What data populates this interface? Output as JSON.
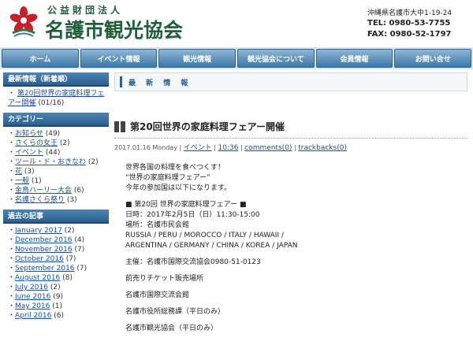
{
  "header": {
    "org_sub": "公益財団法人",
    "org_name": "名護市観光協会",
    "address": "沖縄県名護市大中1-19-24",
    "tel": "TEL: 0980-53-7755",
    "fax": "FAX: 0980-52-1797",
    "logo_icon": "sakura-flower-logo"
  },
  "nav": {
    "items": [
      "ホーム",
      "イベント情報",
      "観光情報",
      "観光協会について",
      "会員情報",
      "お問い合せ"
    ]
  },
  "sidebar": {
    "news": {
      "title": "最新情報（新着順）",
      "items": [
        {
          "label": "第20回世界の家庭料理フェアー開催",
          "count": "(01/16)"
        }
      ]
    },
    "categories": {
      "title": "カテゴリー",
      "items": [
        {
          "label": "お知らせ",
          "count": "(49)"
        },
        {
          "label": "さくらの女王",
          "count": "(2)"
        },
        {
          "label": "イベント",
          "count": "(44)"
        },
        {
          "label": "ツール・ド・おきなわ",
          "count": "(2)"
        },
        {
          "label": "花",
          "count": "(3)"
        },
        {
          "label": "一般",
          "count": "(1)"
        },
        {
          "label": "金鳥ハーリー大会",
          "count": "(6)"
        },
        {
          "label": "名護さくら祭り",
          "count": "(3)"
        }
      ]
    },
    "archive": {
      "title": "過去の記事",
      "items": [
        {
          "label": "January 2017",
          "count": "(2)"
        },
        {
          "label": "December 2016",
          "count": "(4)"
        },
        {
          "label": "November 2016",
          "count": "(7)"
        },
        {
          "label": "October 2016",
          "count": "(7)"
        },
        {
          "label": "September 2016",
          "count": "(7)"
        },
        {
          "label": "August 2016",
          "count": "(8)"
        },
        {
          "label": "July 2016",
          "count": "(2)"
        },
        {
          "label": "June 2016",
          "count": "(9)"
        },
        {
          "label": "May 2016",
          "count": "(1)"
        },
        {
          "label": "April 2016",
          "count": "(6)"
        }
      ]
    }
  },
  "main": {
    "section_title": "最 新 情 報",
    "entry": {
      "title": "第20回世界の家庭料理フェアー開催",
      "date": "2017.01.16 Monday",
      "category": "イベント",
      "time": "10:36",
      "comments": "comments(0)",
      "trackbacks": "trackbacks(0)",
      "body": [
        "世界各国の料理を食べつくす！",
        "“世界の家庭料理フェアー”",
        "今年の参加国は以下になります。",
        "",
        "■ 第20回 世界の家庭料理フェアー ■",
        "日時：2017年2月5日（日）11:30-15:00",
        "場所：名護市民会館",
        "RUSSIA / PERU / MOROCCO / ITALY / HAWAII /",
        "ARGENTINA / GERMANY / CHINA / KOREA / JAPAN",
        "",
        "主催：名護市国際交流協会0980-51-0123",
        "",
        "前売りチケット販売場所",
        "",
        "名護市国際交流会館",
        "",
        "名護市役所総務課（平日のみ）",
        "",
        "名護市観光協会（平日のみ）"
      ]
    }
  },
  "colors": {
    "brand_green": "#1f5f3a",
    "nav_blue": "#3d78a8",
    "link_blue": "#1a4fa3",
    "logo_red": "#c8202a"
  }
}
